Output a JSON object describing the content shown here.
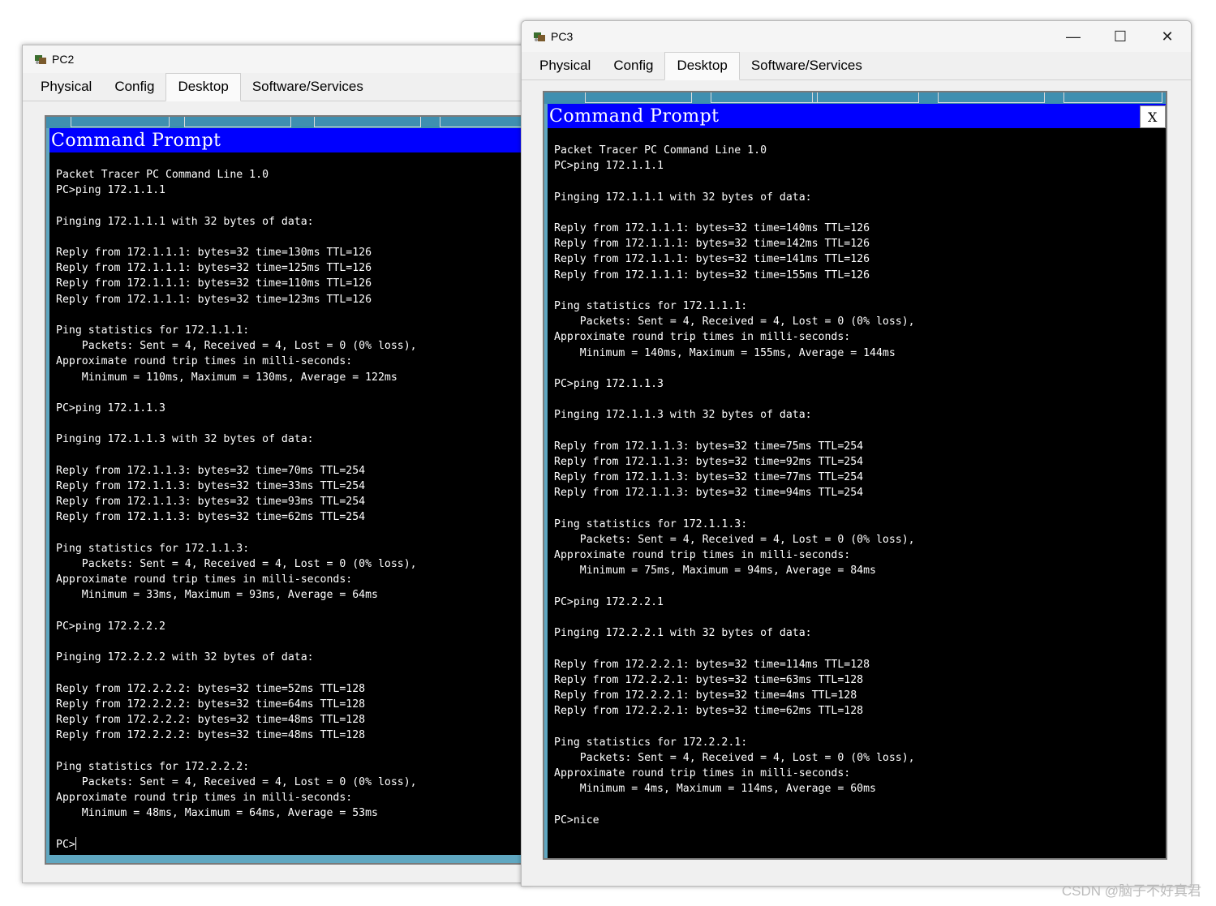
{
  "pc2": {
    "title": "PC2",
    "tabs": [
      "Physical",
      "Config",
      "Desktop",
      "Software/Services"
    ],
    "active_tab": "Desktop",
    "cmd_title": "Command Prompt",
    "console": "Packet Tracer PC Command Line 1.0\nPC>ping 172.1.1.1\n\nPinging 172.1.1.1 with 32 bytes of data:\n\nReply from 172.1.1.1: bytes=32 time=130ms TTL=126\nReply from 172.1.1.1: bytes=32 time=125ms TTL=126\nReply from 172.1.1.1: bytes=32 time=110ms TTL=126\nReply from 172.1.1.1: bytes=32 time=123ms TTL=126\n\nPing statistics for 172.1.1.1:\n    Packets: Sent = 4, Received = 4, Lost = 0 (0% loss),\nApproximate round trip times in milli-seconds:\n    Minimum = 110ms, Maximum = 130ms, Average = 122ms\n\nPC>ping 172.1.1.3\n\nPinging 172.1.1.3 with 32 bytes of data:\n\nReply from 172.1.1.3: bytes=32 time=70ms TTL=254\nReply from 172.1.1.3: bytes=32 time=33ms TTL=254\nReply from 172.1.1.3: bytes=32 time=93ms TTL=254\nReply from 172.1.1.3: bytes=32 time=62ms TTL=254\n\nPing statistics for 172.1.1.3:\n    Packets: Sent = 4, Received = 4, Lost = 0 (0% loss),\nApproximate round trip times in milli-seconds:\n    Minimum = 33ms, Maximum = 93ms, Average = 64ms\n\nPC>ping 172.2.2.2\n\nPinging 172.2.2.2 with 32 bytes of data:\n\nReply from 172.2.2.2: bytes=32 time=52ms TTL=128\nReply from 172.2.2.2: bytes=32 time=64ms TTL=128\nReply from 172.2.2.2: bytes=32 time=48ms TTL=128\nReply from 172.2.2.2: bytes=32 time=48ms TTL=128\n\nPing statistics for 172.2.2.2:\n    Packets: Sent = 4, Received = 4, Lost = 0 (0% loss),\nApproximate round trip times in milli-seconds:\n    Minimum = 48ms, Maximum = 64ms, Average = 53ms\n\n",
    "prompt": "PC>"
  },
  "pc3": {
    "title": "PC3",
    "tabs": [
      "Physical",
      "Config",
      "Desktop",
      "Software/Services"
    ],
    "active_tab": "Desktop",
    "cmd_title": "Command Prompt",
    "close_label": "X",
    "window_controls": {
      "minimize": "—",
      "maximize": "☐",
      "close": "✕"
    },
    "console": "Packet Tracer PC Command Line 1.0\nPC>ping 172.1.1.1\n\nPinging 172.1.1.1 with 32 bytes of data:\n\nReply from 172.1.1.1: bytes=32 time=140ms TTL=126\nReply from 172.1.1.1: bytes=32 time=142ms TTL=126\nReply from 172.1.1.1: bytes=32 time=141ms TTL=126\nReply from 172.1.1.1: bytes=32 time=155ms TTL=126\n\nPing statistics for 172.1.1.1:\n    Packets: Sent = 4, Received = 4, Lost = 0 (0% loss),\nApproximate round trip times in milli-seconds:\n    Minimum = 140ms, Maximum = 155ms, Average = 144ms\n\nPC>ping 172.1.1.3\n\nPinging 172.1.1.3 with 32 bytes of data:\n\nReply from 172.1.1.3: bytes=32 time=75ms TTL=254\nReply from 172.1.1.3: bytes=32 time=92ms TTL=254\nReply from 172.1.1.3: bytes=32 time=77ms TTL=254\nReply from 172.1.1.3: bytes=32 time=94ms TTL=254\n\nPing statistics for 172.1.1.3:\n    Packets: Sent = 4, Received = 4, Lost = 0 (0% loss),\nApproximate round trip times in milli-seconds:\n    Minimum = 75ms, Maximum = 94ms, Average = 84ms\n\nPC>ping 172.2.2.1\n\nPinging 172.2.2.1 with 32 bytes of data:\n\nReply from 172.2.2.1: bytes=32 time=114ms TTL=128\nReply from 172.2.2.1: bytes=32 time=63ms TTL=128\nReply from 172.2.2.1: bytes=32 time=4ms TTL=128\nReply from 172.2.2.1: bytes=32 time=62ms TTL=128\n\nPing statistics for 172.2.2.1:\n    Packets: Sent = 4, Received = 4, Lost = 0 (0% loss),\nApproximate round trip times in milli-seconds:\n    Minimum = 4ms, Maximum = 114ms, Average = 60ms\n\nPC>nice"
  },
  "watermark": "CSDN @脑子不好真君",
  "colors": {
    "cmd_title_bg": "#0000ff",
    "console_bg": "#000000",
    "desktop_bg": "#5fa7c1"
  }
}
